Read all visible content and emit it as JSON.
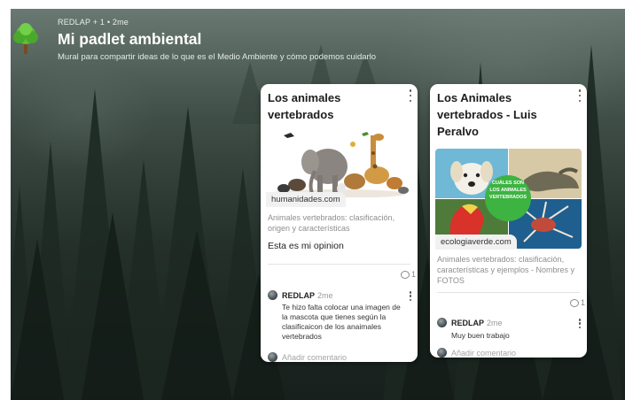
{
  "board": {
    "meta": "REDLAP + 1 • 2me",
    "title": "Mi padlet ambiental",
    "subtitle": "Mural para compartir ideas de lo que es el Medio Ambiente y cómo podemos cuidarlo"
  },
  "cards": [
    {
      "title": "Los animales vertebrados",
      "link": "humanidades.com",
      "description": "Animales vertebrados: clasificación, origen y características",
      "body": "Esta es mi opinion",
      "comment_count": "1",
      "comment": {
        "author": "REDLAP",
        "time": "2me",
        "text": "Te hizo falta colocar una imagen de la mascota que tienes según la clasificaicon de los anaimales vertebrados"
      },
      "add_comment": "Añadir comentario"
    },
    {
      "title": "Los Animales vertebrados  - Luis Peralvo",
      "link": "ecologiaverde.com",
      "badge": "CUÁLES SON LOS ANIMALES VERTEBRADOS",
      "description": "Animales vertebrados: clasificación, características y ejemplos - Nombres y FOTOS",
      "comment_count": "1",
      "comment": {
        "author": "REDLAP",
        "time": "2me",
        "text": "Muy buen trabajo"
      },
      "add_comment": "Añadir comentario"
    }
  ]
}
